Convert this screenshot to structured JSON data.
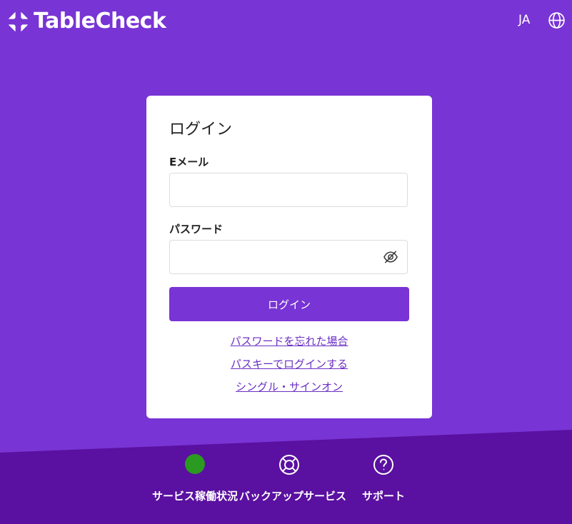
{
  "header": {
    "brand": "TableCheck",
    "language": "JA",
    "logo_icon": "tablecheck-logo-icon",
    "globe_icon": "globe-icon"
  },
  "login": {
    "title": "ログイン",
    "email_label": "Eメール",
    "email_value": "",
    "password_label": "パスワード",
    "password_value": "",
    "password_toggle_icon": "eye-off-icon",
    "submit_label": "ログイン",
    "links": {
      "forgot_password": "パスワードを忘れた場合",
      "passkey": "パスキーでログインする",
      "sso": "シングル・サインオン"
    }
  },
  "footer": {
    "items": [
      {
        "label": "サービス稼働状況",
        "icon": "status-dot-icon"
      },
      {
        "label": "バックアップサービス",
        "icon": "lifebuoy-icon"
      },
      {
        "label": "サポート",
        "icon": "help-circle-icon"
      }
    ]
  },
  "colors": {
    "brand_purple": "#7834d4",
    "footer_purple": "#5a10a0",
    "link_purple": "#6b2fc4",
    "status_green": "#2a9a21",
    "card_bg": "#ffffff"
  }
}
